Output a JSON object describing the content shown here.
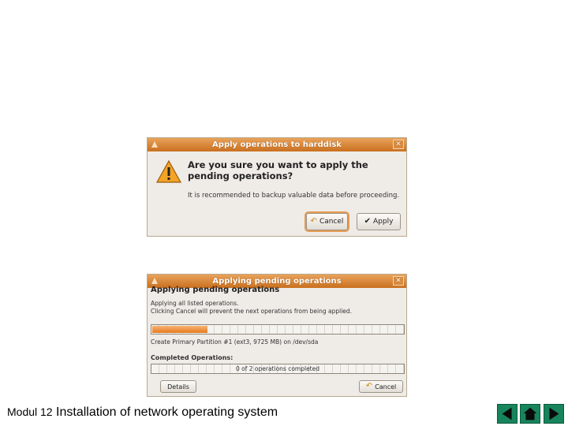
{
  "dialog1": {
    "title": "Apply operations to harddisk",
    "question": "Are you sure you want to apply the pending operations?",
    "note": "It is recommended to backup valuable data before proceeding.",
    "cancel_label": "Cancel",
    "apply_label": "Apply"
  },
  "dialog2": {
    "title": "Applying pending operations",
    "heading": "Applying pending operations",
    "line1": "Applying all listed operations.",
    "line2": "Clicking Cancel will prevent the next operations from being applied.",
    "progress_fraction": 0.22,
    "current_operation": "Create Primary Partition #1 (ext3, 9725 MB) on /dev/sda",
    "completed_label": "Completed Operations:",
    "completed_text": "0 of 2 operations completed",
    "details_label": "Details",
    "cancel_label": "Cancel"
  },
  "footer": {
    "module": "Modul 12",
    "title": "Installation of network operating system"
  },
  "colors": {
    "titlebar": "#c96f1f",
    "nav": "#17845c",
    "progress": "#e77a1e"
  }
}
